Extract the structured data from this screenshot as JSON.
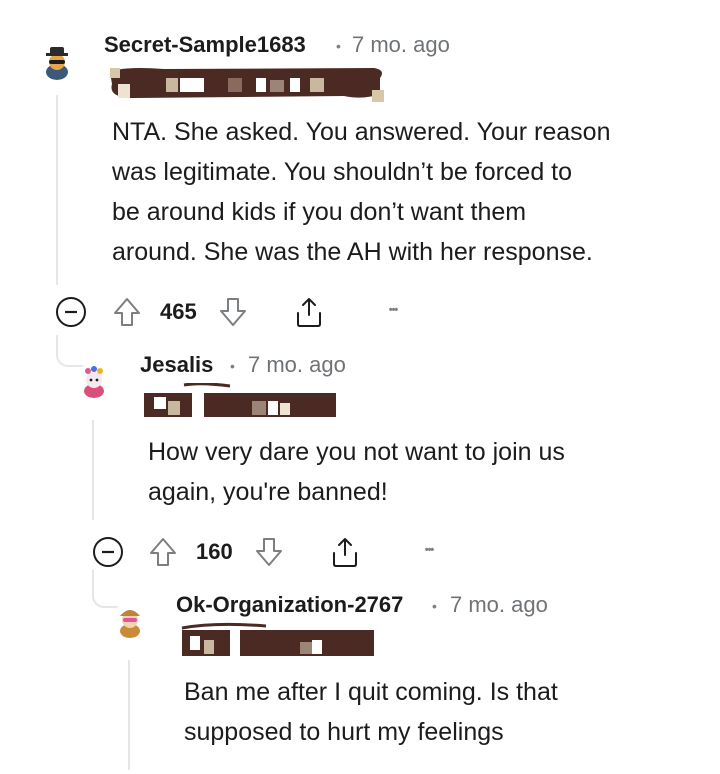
{
  "comments": [
    {
      "username": "Secret-Sample1683",
      "separator": "•",
      "time": "7 mo. ago",
      "body_lines": [
        "NTA. She asked. You answered. Your reason",
        "was legitimate. You shouldn’t be forced to",
        "be around kids if you don’t want them",
        "around. She was the AH with her response."
      ],
      "votes": "465",
      "more_label": "•••",
      "avatar_icon": "avatar-icon"
    },
    {
      "username": "Jesalis",
      "separator": "•",
      "time": "7 mo. ago",
      "body_lines": [
        "How very dare you not want to join us",
        "again, you're banned!"
      ],
      "votes": "160",
      "more_label": "•••",
      "avatar_icon": "avatar-icon"
    },
    {
      "username": "Ok-Organization-2767",
      "separator": "•",
      "time": "7 mo. ago",
      "body_lines": [
        "Ban me after I quit coming. Is that",
        "supposed to hurt my feelings"
      ],
      "avatar_icon": "avatar-icon"
    }
  ],
  "colors": {
    "text": "#1c1c1c",
    "muted": "#6f7377",
    "thread_line": "#e4e6e8",
    "redaction_dark": "#4a2a22"
  }
}
